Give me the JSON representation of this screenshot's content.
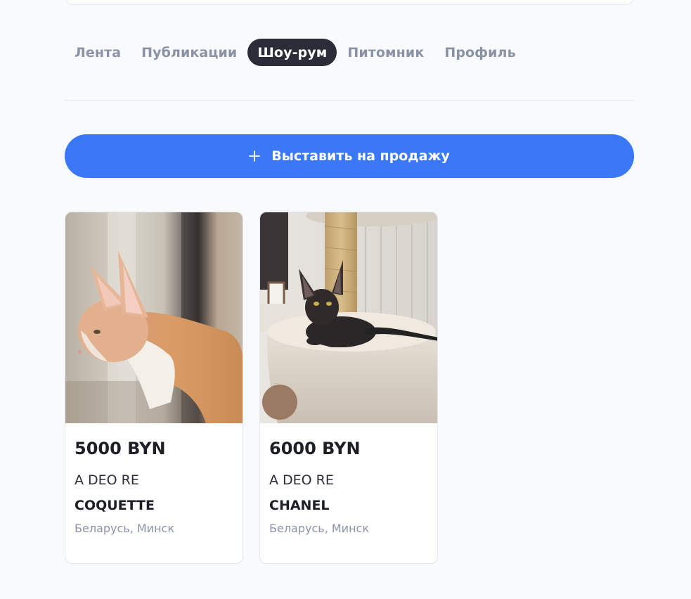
{
  "tabs": [
    {
      "label": "Лента",
      "active": false
    },
    {
      "label": "Публикации",
      "active": false
    },
    {
      "label": "Шоу-рум",
      "active": true
    },
    {
      "label": "Питомник",
      "active": false
    },
    {
      "label": "Профиль",
      "active": false
    }
  ],
  "sell_button": {
    "label": "Выставить на продажу",
    "icon": "plus-icon"
  },
  "listings": [
    {
      "price": "5000 BYN",
      "breed": "A DEO RE",
      "name": "COQUETTE",
      "location": "Беларусь, Минск",
      "photo": "orange-white-cornish-rex-cat-photo"
    },
    {
      "price": "6000 BYN",
      "breed": "A DEO RE",
      "name": "CHANEL",
      "location": "Беларусь, Минск",
      "photo": "black-cornish-rex-cat-photo"
    }
  ],
  "colors": {
    "accent": "#3a78f7",
    "active_tab": "#2a2c37",
    "muted_text": "#8a93a6",
    "background": "#f8fafd"
  }
}
